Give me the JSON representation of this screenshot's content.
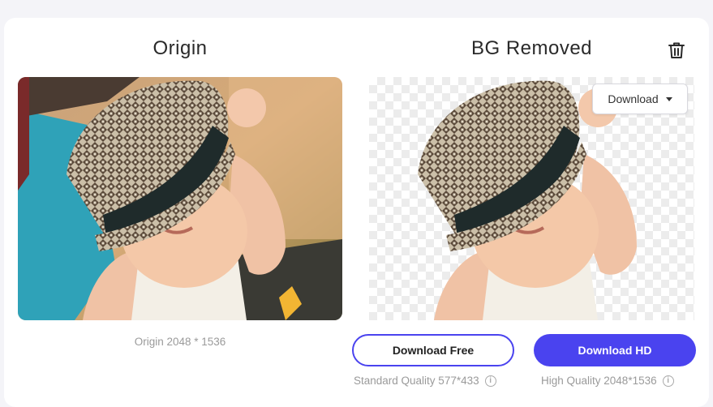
{
  "panels": {
    "origin": {
      "title": "Origin",
      "size_label": "Origin 2048 * 1536"
    },
    "removed": {
      "title": "BG Removed",
      "download_menu_label": "Download",
      "delete_icon": "trash-icon"
    }
  },
  "actions": {
    "download_free": {
      "label": "Download Free",
      "quality": "Standard Quality 577*433"
    },
    "download_hd": {
      "label": "Download HD",
      "quality": "High Quality 2048*1536"
    }
  },
  "icons": {
    "info": "info-icon",
    "caret": "caret-down-icon"
  },
  "colors": {
    "accent": "#4a43ef",
    "card_bg": "#ffffff",
    "page_bg": "#f4f4f8"
  }
}
